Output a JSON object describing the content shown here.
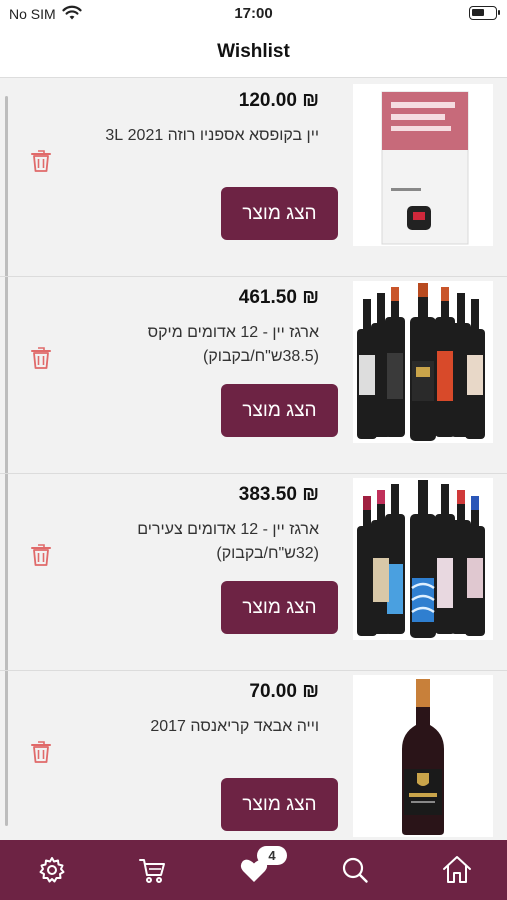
{
  "status_bar": {
    "carrier": "No SIM",
    "time": "17:00",
    "battery_level": 0.55
  },
  "header": {
    "title": "Wishlist"
  },
  "colors": {
    "brand": "#6d2344",
    "trash": "#e06a6a",
    "background": "#f2f2f2"
  },
  "items": [
    {
      "price": "₪ 120.00",
      "name": "יין בקופסא אספניו רוזה 2021 3L",
      "button_label": "הצג מוצר",
      "image_icon": "wine-box-icon"
    },
    {
      "price": "₪ 461.50",
      "name": "ארגז יין - 12 אדומים מיקס (38.5ש\"ח/בקבוק)",
      "button_label": "הצג מוצר",
      "image_icon": "wine-bottles-icon"
    },
    {
      "price": "₪ 383.50",
      "name": "ארגז יין - 12 אדומים צעירים (32ש\"ח/בקבוק)",
      "button_label": "הצג מוצר",
      "image_icon": "wine-bottles-icon"
    },
    {
      "price": "₪ 70.00",
      "name": "וייה אבאד קריאנסה 2017",
      "button_label": "הצג מוצר",
      "image_icon": "wine-bottle-icon"
    }
  ],
  "tab_bar": {
    "tabs": [
      {
        "icon": "gear-icon"
      },
      {
        "icon": "cart-icon"
      },
      {
        "icon": "heart-icon",
        "badge": "4"
      },
      {
        "icon": "search-icon"
      },
      {
        "icon": "home-icon"
      }
    ]
  }
}
